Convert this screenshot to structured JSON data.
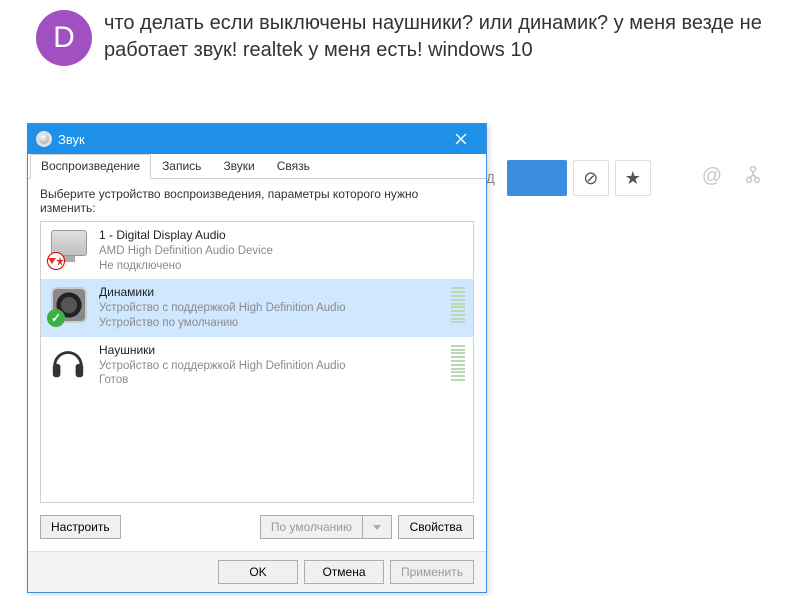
{
  "post": {
    "avatar_letter": "D",
    "text": "что делать если выключены наушники? или динамик? у меня везде не работает звук! realtek у меня есть! windows 10"
  },
  "toolbar": {
    "peek_letter": "Д"
  },
  "dialog": {
    "title": "Звук",
    "tabs": [
      "Воспроизведение",
      "Запись",
      "Звуки",
      "Связь"
    ],
    "active_tab": 0,
    "instruction": "Выберите устройство воспроизведения, параметры которого нужно изменить:",
    "devices": [
      {
        "name": "1 - Digital Display Audio",
        "sub": "AMD High Definition Audio Device",
        "status": "Не подключено",
        "icon": "monitor",
        "badge": "err",
        "meter": false
      },
      {
        "name": "Динамики",
        "sub": "Устройство с поддержкой High Definition Audio",
        "status": "Устройство по умолчанию",
        "icon": "speaker",
        "badge": "ok",
        "meter": true
      },
      {
        "name": "Наушники",
        "sub": "Устройство с поддержкой High Definition Audio",
        "status": "Готов",
        "icon": "headphones",
        "badge": "",
        "meter": true
      }
    ],
    "selected_device": 1,
    "buttons": {
      "configure": "Настроить",
      "default": "По умолчанию",
      "properties": "Свойства",
      "ok": "OK",
      "cancel": "Отмена",
      "apply": "Применить"
    }
  }
}
